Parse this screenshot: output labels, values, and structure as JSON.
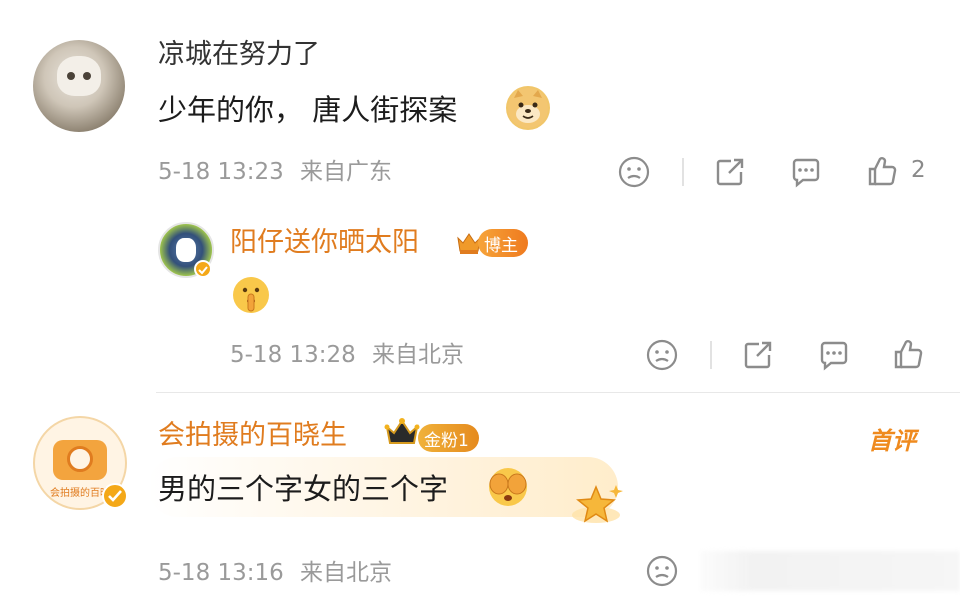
{
  "comments": [
    {
      "user": "凉城在努力了",
      "text": "少年的你， 唐人街探案",
      "time": "5-18 13:23",
      "location": "来自广东",
      "like_count": "2"
    },
    {
      "user": "阳仔送你晒太阳",
      "badge": "博主",
      "time": "5-18 13:28",
      "location": "来自北京"
    },
    {
      "user": "会拍摄的百晓生",
      "badge": "金粉1",
      "tag": "首评",
      "text": "男的三个字女的三个字",
      "time": "5-18 13:16",
      "location": "来自北京",
      "avatar_caption": "会拍摄的百晓"
    }
  ],
  "colors": {
    "accent_orange": "#e8821e",
    "gray_text": "#9a9a9a",
    "icon_gray": "#8c8c8c"
  }
}
